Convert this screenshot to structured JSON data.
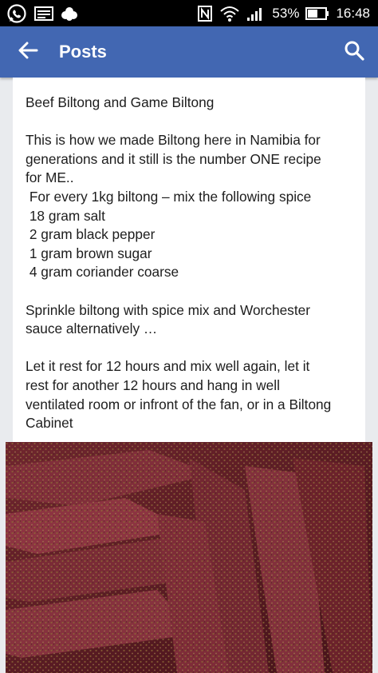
{
  "status_bar": {
    "icons_left": [
      "whatsapp-icon",
      "image-icon",
      "badge-icon"
    ],
    "icons_right": [
      "nfc-icon",
      "wifi-icon",
      "signal-icon"
    ],
    "battery": "53%",
    "time": "16:48"
  },
  "app_bar": {
    "title": "Posts",
    "back_icon": "arrow-left-icon",
    "search_icon": "search-icon",
    "color": "#4267b2"
  },
  "post": {
    "lines": [
      "Beef Biltong and Game Biltong",
      "",
      "This is how we made Biltong here in Namibia for",
      "generations and it still is the number ONE recipe",
      "for ME..",
      " For every 1kg biltong – mix the following spice",
      " 18 gram salt",
      " 2 gram black pepper",
      " 1 gram brown sugar",
      " 4 gram coriander coarse",
      "",
      "Sprinkle biltong with spice mix and Worchester",
      "sauce alternatively …",
      "",
      "Let it rest for 12 hours and mix well again, let it",
      "rest for another 12 hours and hang in well",
      "ventilated room or infront of the fan, or in a Biltong",
      "Cabinet"
    ]
  },
  "photo": {
    "subject": "meat-strips-with-spice"
  }
}
